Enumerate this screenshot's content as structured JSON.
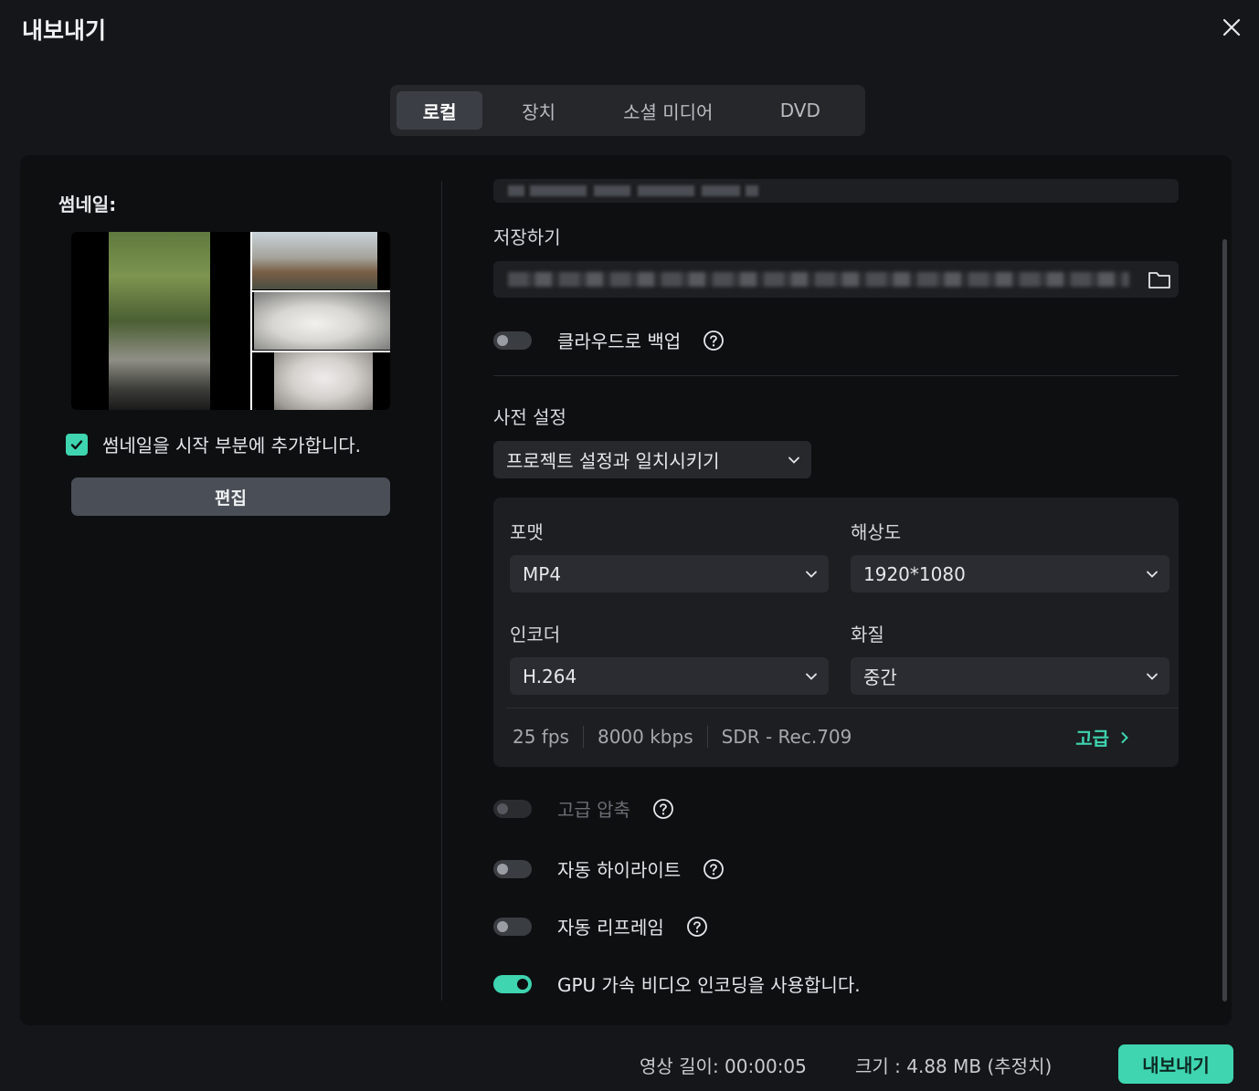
{
  "window": {
    "title": "내보내기"
  },
  "tabs": [
    {
      "label": "로컬",
      "active": true
    },
    {
      "label": "장치",
      "active": false
    },
    {
      "label": "소셜 미디어",
      "active": false
    },
    {
      "label": "DVD",
      "active": false
    }
  ],
  "thumbnail": {
    "label": "썸네일:",
    "add_to_start_label": "썸네일을 시작 부분에 추가합니다.",
    "add_to_start_checked": true,
    "edit_button": "편집"
  },
  "save": {
    "label": "저장하기",
    "folder_icon": "folder-icon"
  },
  "cloud_backup": {
    "label": "클라우드로 백업",
    "enabled": false
  },
  "preset": {
    "label": "사전 설정",
    "selected": "프로젝트 설정과 일치시키기"
  },
  "settings": {
    "format": {
      "label": "포맷",
      "value": "MP4"
    },
    "resolution": {
      "label": "해상도",
      "value": "1920*1080"
    },
    "encoder": {
      "label": "인코더",
      "value": "H.264"
    },
    "quality": {
      "label": "화질",
      "value": "중간"
    },
    "fps": "25 fps",
    "bitrate": "8000 kbps",
    "color": "SDR - Rec.709",
    "advanced_link": "고급"
  },
  "toggles": {
    "high_compression": {
      "label": "고급 압축",
      "enabled": false,
      "disabled": true
    },
    "auto_highlight": {
      "label": "자동 하이라이트",
      "enabled": false
    },
    "auto_reframe": {
      "label": "자동 리프레임",
      "enabled": false
    },
    "gpu_encoding": {
      "label": "GPU 가속 비디오 인코딩을 사용합니다.",
      "enabled": true
    }
  },
  "footer": {
    "duration": "영상 길이: 00:00:05",
    "size": "크기 :  4.88 MB (추정치)",
    "export_button": "내보내기"
  },
  "colors": {
    "accent": "#3ed5b0",
    "background": "#151619",
    "panel": "#0e0f11"
  }
}
